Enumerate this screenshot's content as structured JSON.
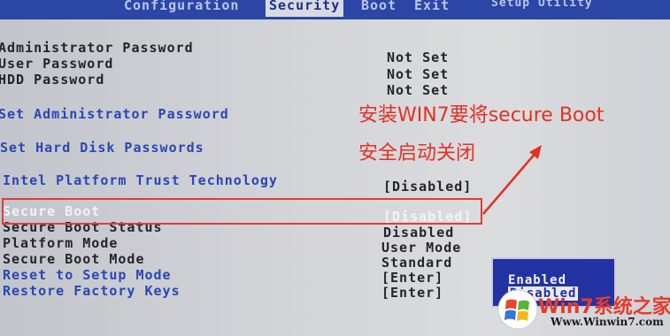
{
  "menu": {
    "tabs": [
      "Configuration",
      "Security",
      "Boot",
      "Exit"
    ],
    "utility_title": "Setup Utility"
  },
  "security": {
    "rows": [
      {
        "label": "Administrator Password",
        "value": "Not Set"
      },
      {
        "label": "User Password",
        "value": "Not Set"
      },
      {
        "label": "HDD Password",
        "value": "Not Set"
      },
      {
        "label": "Set Administrator Password",
        "value": ""
      },
      {
        "label": "Set Hard Disk Passwords",
        "value": ""
      },
      {
        "label": "Intel Platform Trust Technology",
        "value": "[Disabled]"
      },
      {
        "label": "Secure Boot",
        "value": "[Disabled]"
      },
      {
        "label": "Secure Boot Status",
        "value": "Disabled"
      },
      {
        "label": "Platform Mode",
        "value": "User Mode"
      },
      {
        "label": "Secure Boot Mode",
        "value": "Standard"
      },
      {
        "label": "Reset to Setup Mode",
        "value": "[Enter]"
      },
      {
        "label": "Restore Factory Keys",
        "value": "[Enter]"
      }
    ]
  },
  "popup": {
    "options": [
      "Enabled",
      "Disabled"
    ],
    "selected": "Disabled"
  },
  "annotation": {
    "line1": "安装WIN7要将secure Boot",
    "line2": "安全启动关闭",
    "color": "#e53024"
  },
  "watermark": {
    "brand": "Win7系统之家",
    "url": "Www.Winwin7.com"
  }
}
